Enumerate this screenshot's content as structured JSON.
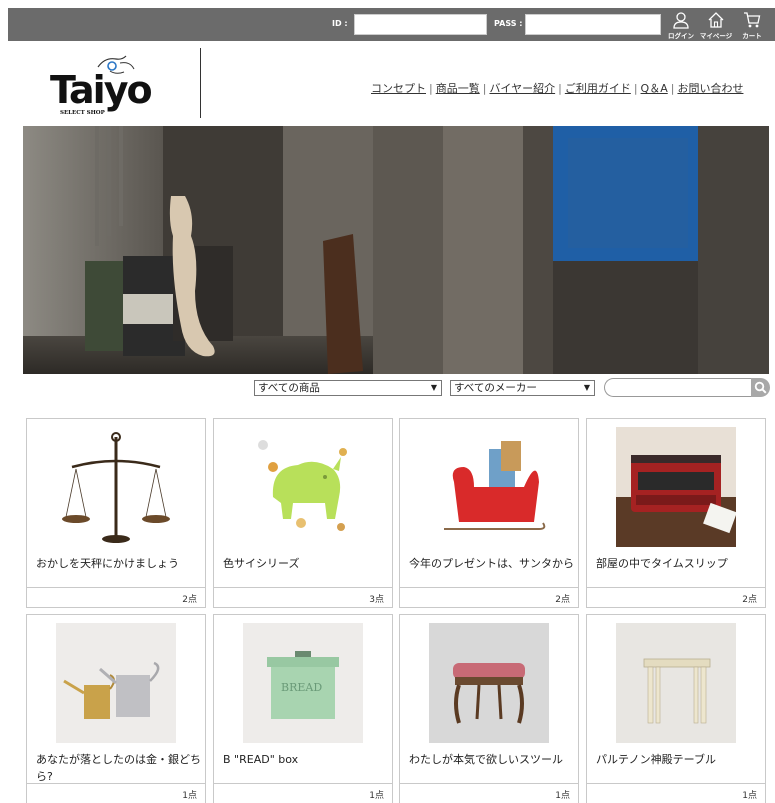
{
  "topbar": {
    "id_label": "ID :",
    "pass_label": "PASS :",
    "id_value": "",
    "pass_value": "",
    "login_label": "ログイン",
    "mypage_label": "マイページ",
    "cart_label": "カート",
    "icons": [
      "person-icon",
      "home-icon",
      "cart-icon"
    ]
  },
  "brand": {
    "logo_text": "Taiyo",
    "tagline": "SELECT SHOP"
  },
  "nav": {
    "items": [
      {
        "label": "コンセプト"
      },
      {
        "label": "商品一覧"
      },
      {
        "label": "バイヤー紹介"
      },
      {
        "label": "ご利用ガイド"
      },
      {
        "label": "Q＆A"
      },
      {
        "label": "お問い合わせ"
      }
    ]
  },
  "search": {
    "category_selected": "すべての商品",
    "maker_selected": "すべてのメーカー",
    "query": "",
    "icon": "search-icon"
  },
  "products": [
    {
      "title": "おかしを天秤にかけましょう",
      "count": "2点",
      "image": "balance-scale"
    },
    {
      "title": "色サイシリーズ",
      "count": "3点",
      "image": "green-rhino"
    },
    {
      "title": "今年のプレゼントは、サンタから",
      "count": "2点",
      "image": "red-sleigh"
    },
    {
      "title": "部屋の中でタイムスリップ",
      "count": "2点",
      "image": "red-typewriter"
    },
    {
      "title": "あなたが落としたのは金・銀どちら?",
      "count": "1点",
      "image": "watering-cans"
    },
    {
      "title": "B \"READ\" box",
      "count": "1点",
      "image": "bread-box"
    },
    {
      "title": "わたしが本気で欲しいスツール",
      "count": "1点",
      "image": "pink-stool"
    },
    {
      "title": "パルテノン神殿テーブル",
      "count": "1点",
      "image": "column-table"
    }
  ],
  "colors": {
    "topbar_bg": "#6b6b6b",
    "card_border": "#c9c9c9",
    "search_button": "#a8a8a8"
  }
}
